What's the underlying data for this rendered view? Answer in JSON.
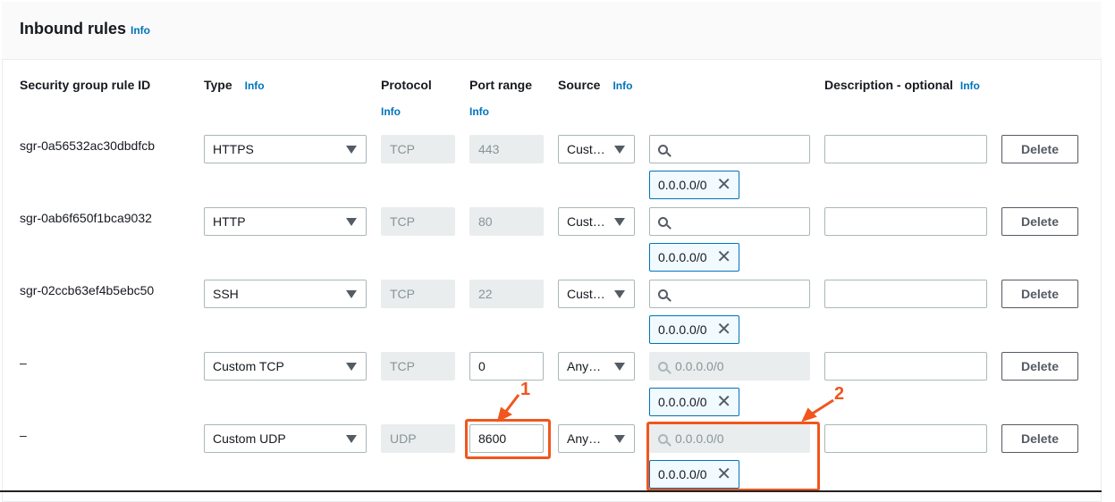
{
  "header": {
    "title": "Inbound rules",
    "info": "Info"
  },
  "columns": {
    "rule_id": "Security group rule ID",
    "type": "Type",
    "type_info": "Info",
    "protocol": "Protocol",
    "protocol_info": "Info",
    "port_range": "Port range",
    "port_info": "Info",
    "source": "Source",
    "source_info": "Info",
    "description": "Description - optional",
    "description_info": "Info"
  },
  "rows": [
    {
      "id": "sgr-0a56532ac30dbdfcb",
      "type": "HTTPS",
      "protocol": "TCP",
      "port": "443",
      "port_editable": false,
      "source": "Cust…",
      "search": "",
      "search_placeholder": "",
      "search_disabled": false,
      "tag": "0.0.0.0/0",
      "description": "",
      "delete": "Delete"
    },
    {
      "id": "sgr-0ab6f650f1bca9032",
      "type": "HTTP",
      "protocol": "TCP",
      "port": "80",
      "port_editable": false,
      "source": "Cust…",
      "search": "",
      "search_placeholder": "",
      "search_disabled": false,
      "tag": "0.0.0.0/0",
      "description": "",
      "delete": "Delete"
    },
    {
      "id": "sgr-02ccb63ef4b5ebc50",
      "type": "SSH",
      "protocol": "TCP",
      "port": "22",
      "port_editable": false,
      "source": "Cust…",
      "search": "",
      "search_placeholder": "",
      "search_disabled": false,
      "tag": "0.0.0.0/0",
      "description": "",
      "delete": "Delete"
    },
    {
      "id": "–",
      "type": "Custom TCP",
      "protocol": "TCP",
      "port": "0",
      "port_editable": true,
      "source": "Any…",
      "search": "",
      "search_placeholder": "0.0.0.0/0",
      "search_disabled": true,
      "tag": "0.0.0.0/0",
      "description": "",
      "delete": "Delete"
    },
    {
      "id": "–",
      "type": "Custom UDP",
      "protocol": "UDP",
      "port": "8600",
      "port_editable": true,
      "source": "Any…",
      "search": "",
      "search_placeholder": "0.0.0.0/0",
      "search_disabled": true,
      "tag": "0.0.0.0/0",
      "description": "",
      "delete": "Delete"
    }
  ],
  "annotations": [
    {
      "label": "1"
    },
    {
      "label": "2"
    }
  ],
  "colors": {
    "accent": "#0073bb",
    "annotation": "#f0561d"
  }
}
